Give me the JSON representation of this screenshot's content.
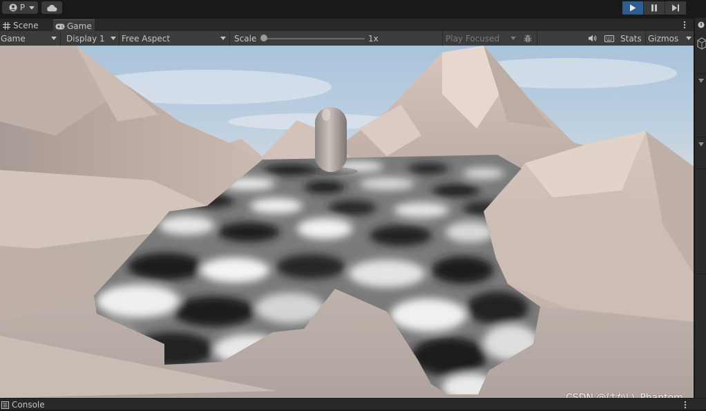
{
  "toolbar": {
    "account_label": "P",
    "icons": [
      "account-icon",
      "cloud-icon",
      "play-icon",
      "pause-icon",
      "step-icon"
    ]
  },
  "tabs": [
    {
      "label": "Scene",
      "icon": "grid-icon"
    },
    {
      "label": "Game",
      "icon": "gamepad-icon",
      "active": true
    }
  ],
  "game_toolbar": {
    "view_select": "Game",
    "display_select": "Display 1",
    "aspect_select": "Free Aspect",
    "scale_label": "Scale",
    "scale_value": "1x",
    "play_mode_select": "Play Focused",
    "stats_label": "Stats",
    "gizmos_label": "Gizmos"
  },
  "bottom": {
    "console_label": "Console"
  },
  "watermark": "CSDN @はかい_Phantom",
  "colors": {
    "play_active": "#2e5d8f",
    "panel_bg": "#3c3c3c",
    "app_bg": "#191919"
  }
}
